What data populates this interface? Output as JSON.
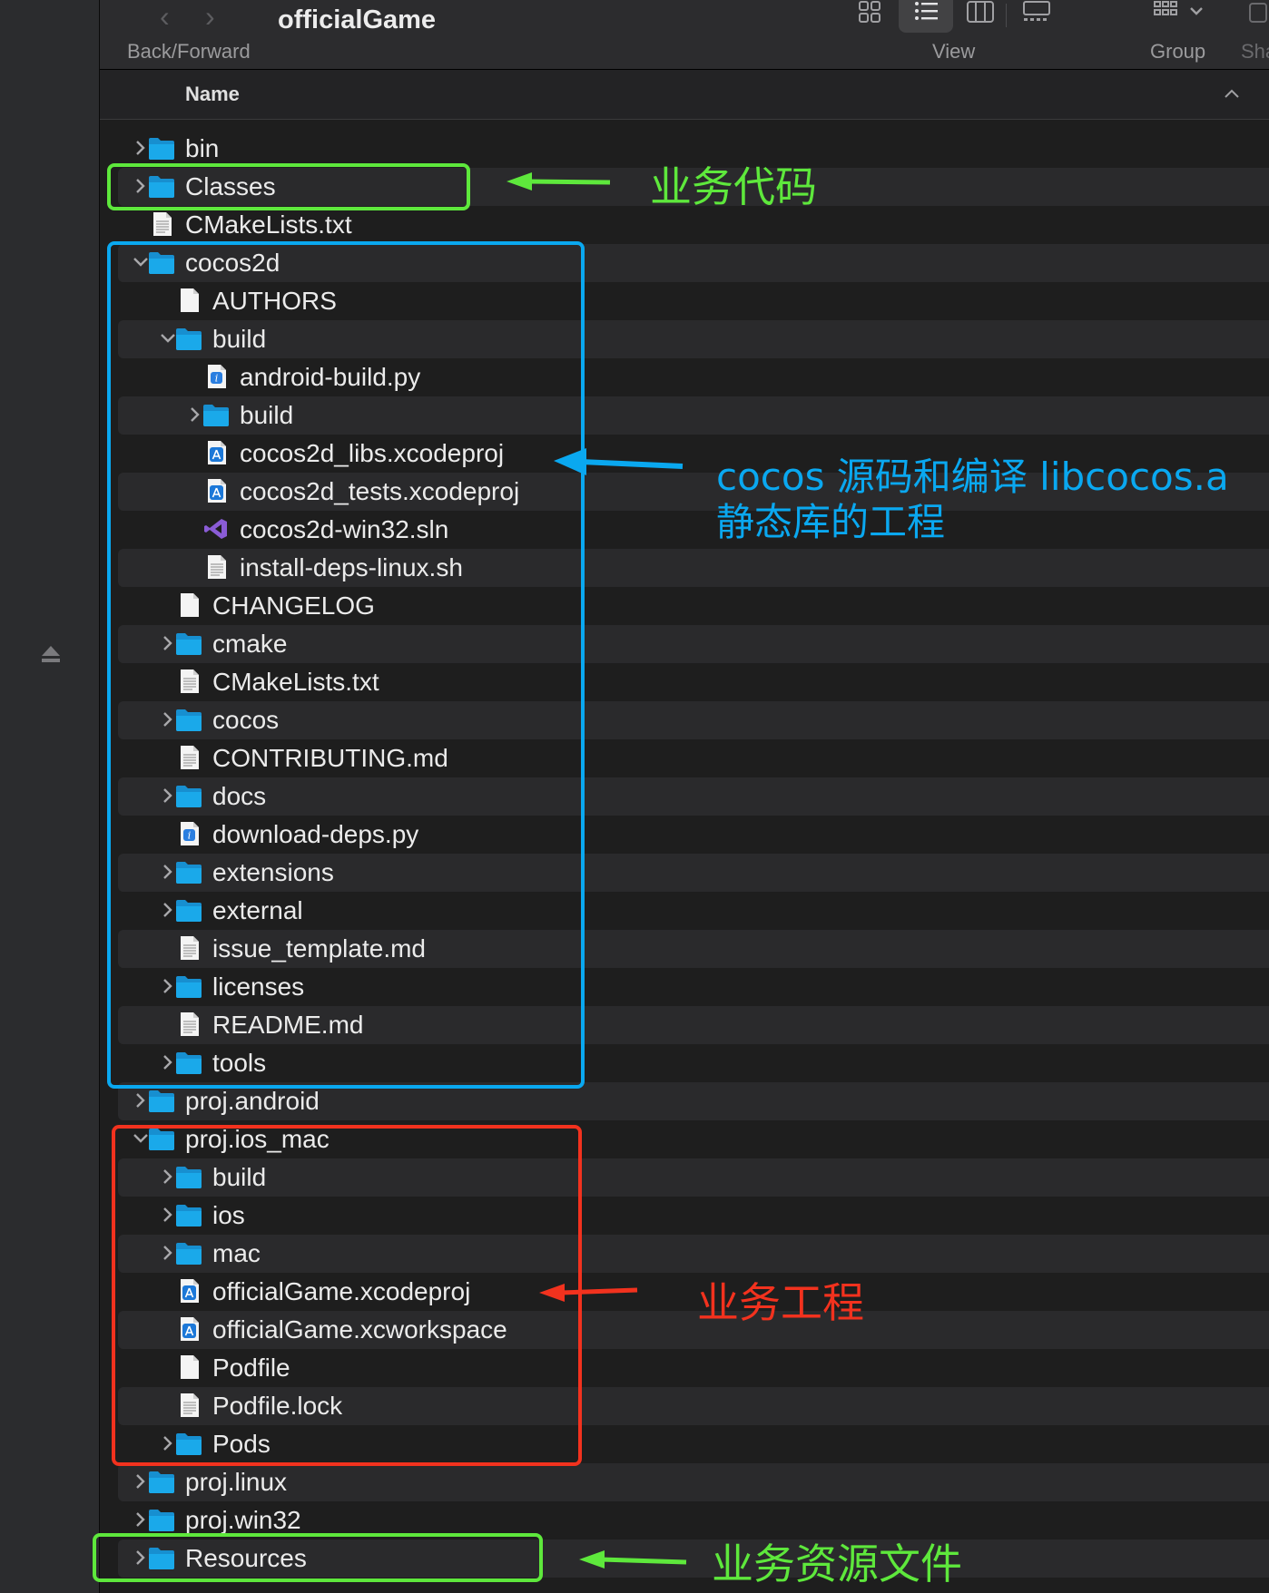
{
  "toolbar": {
    "title": "officialGame",
    "back_forward_label": "Back/Forward",
    "view_label": "View",
    "group_label": "Group",
    "share_label_partial": "Sha"
  },
  "columns": {
    "name": "Name"
  },
  "files": [
    {
      "name": "bin",
      "type": "folder",
      "level": 0,
      "disclosure": "collapsed"
    },
    {
      "name": "Classes",
      "type": "folder",
      "level": 0,
      "disclosure": "collapsed"
    },
    {
      "name": "CMakeLists.txt",
      "type": "text",
      "level": 0,
      "disclosure": "none"
    },
    {
      "name": "cocos2d",
      "type": "folder",
      "level": 0,
      "disclosure": "expanded"
    },
    {
      "name": "AUTHORS",
      "type": "blank",
      "level": 1,
      "disclosure": "none"
    },
    {
      "name": "build",
      "type": "folder",
      "level": 1,
      "disclosure": "expanded"
    },
    {
      "name": "android-build.py",
      "type": "python",
      "level": 2,
      "disclosure": "none"
    },
    {
      "name": "build",
      "type": "folder",
      "level": 2,
      "disclosure": "collapsed"
    },
    {
      "name": "cocos2d_libs.xcodeproj",
      "type": "xcode",
      "level": 2,
      "disclosure": "none"
    },
    {
      "name": "cocos2d_tests.xcodeproj",
      "type": "xcode",
      "level": 2,
      "disclosure": "none"
    },
    {
      "name": "cocos2d-win32.sln",
      "type": "vs",
      "level": 2,
      "disclosure": "none"
    },
    {
      "name": "install-deps-linux.sh",
      "type": "text",
      "level": 2,
      "disclosure": "none"
    },
    {
      "name": "CHANGELOG",
      "type": "blank",
      "level": 1,
      "disclosure": "none"
    },
    {
      "name": "cmake",
      "type": "folder",
      "level": 1,
      "disclosure": "collapsed"
    },
    {
      "name": "CMakeLists.txt",
      "type": "text",
      "level": 1,
      "disclosure": "none"
    },
    {
      "name": "cocos",
      "type": "folder",
      "level": 1,
      "disclosure": "collapsed"
    },
    {
      "name": "CONTRIBUTING.md",
      "type": "text",
      "level": 1,
      "disclosure": "none"
    },
    {
      "name": "docs",
      "type": "folder",
      "level": 1,
      "disclosure": "collapsed"
    },
    {
      "name": "download-deps.py",
      "type": "python",
      "level": 1,
      "disclosure": "none"
    },
    {
      "name": "extensions",
      "type": "folder",
      "level": 1,
      "disclosure": "collapsed"
    },
    {
      "name": "external",
      "type": "folder",
      "level": 1,
      "disclosure": "collapsed"
    },
    {
      "name": "issue_template.md",
      "type": "text",
      "level": 1,
      "disclosure": "none"
    },
    {
      "name": "licenses",
      "type": "folder",
      "level": 1,
      "disclosure": "collapsed"
    },
    {
      "name": "README.md",
      "type": "text",
      "level": 1,
      "disclosure": "none"
    },
    {
      "name": "tools",
      "type": "folder",
      "level": 1,
      "disclosure": "collapsed"
    },
    {
      "name": "proj.android",
      "type": "folder",
      "level": 0,
      "disclosure": "collapsed"
    },
    {
      "name": "proj.ios_mac",
      "type": "folder",
      "level": 0,
      "disclosure": "expanded"
    },
    {
      "name": "build",
      "type": "folder",
      "level": 1,
      "disclosure": "collapsed"
    },
    {
      "name": "ios",
      "type": "folder",
      "level": 1,
      "disclosure": "collapsed"
    },
    {
      "name": "mac",
      "type": "folder",
      "level": 1,
      "disclosure": "collapsed"
    },
    {
      "name": "officialGame.xcodeproj",
      "type": "xcode",
      "level": 1,
      "disclosure": "none"
    },
    {
      "name": "officialGame.xcworkspace",
      "type": "xcode",
      "level": 1,
      "disclosure": "none"
    },
    {
      "name": "Podfile",
      "type": "blank",
      "level": 1,
      "disclosure": "none"
    },
    {
      "name": "Podfile.lock",
      "type": "text",
      "level": 1,
      "disclosure": "none"
    },
    {
      "name": "Pods",
      "type": "folder",
      "level": 1,
      "disclosure": "collapsed"
    },
    {
      "name": "proj.linux",
      "type": "folder",
      "level": 0,
      "disclosure": "collapsed"
    },
    {
      "name": "proj.win32",
      "type": "folder",
      "level": 0,
      "disclosure": "collapsed"
    },
    {
      "name": "Resources",
      "type": "folder",
      "level": 0,
      "disclosure": "collapsed"
    }
  ],
  "annotations": {
    "business_code": "业务代码",
    "cocos_line1": "cocos 源码和编译 libcocos.a",
    "cocos_line2": "静态库的工程",
    "business_project": "业务工程",
    "business_resources": "业务资源文件"
  },
  "colors": {
    "green": "#5ee83c",
    "blue": "#0aa8f0",
    "red": "#f2321e",
    "folder": "#1aa9ea"
  },
  "icons": {
    "folder": "folder-icon",
    "text": "text-document-icon",
    "blank": "blank-document-icon",
    "python": "python-file-icon",
    "xcode": "xcode-project-icon",
    "vs": "visual-studio-solution-icon"
  }
}
